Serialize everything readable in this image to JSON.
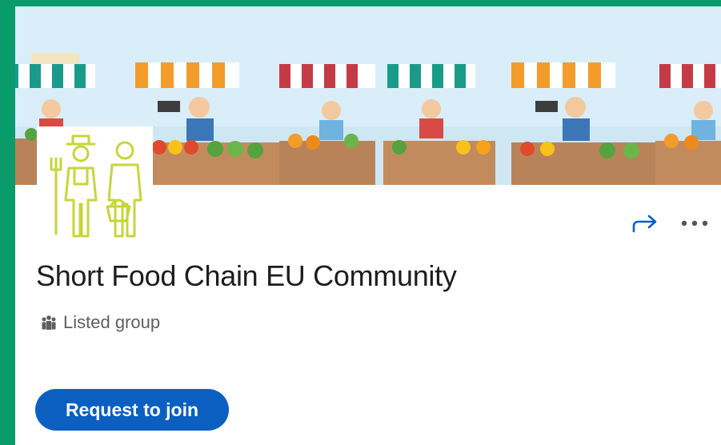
{
  "group": {
    "name": "Short Food Chain EU Community",
    "visibility_label": "Listed group"
  },
  "actions": {
    "join_label": "Request to join",
    "share_icon": "share-arrow-icon",
    "more_icon": "more-horizontal-icon"
  },
  "colors": {
    "frame": "#0a9b6b",
    "primary": "#0b5fc1",
    "share_icon": "#0b5fc1",
    "logo_line": "#c5d63a"
  }
}
